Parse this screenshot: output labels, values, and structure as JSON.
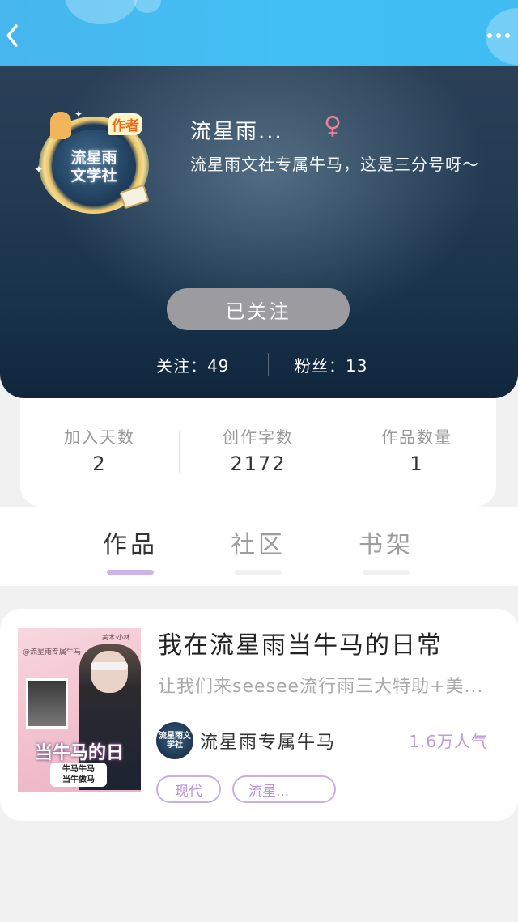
{
  "topbar": {
    "back_icon": "chevron-left-icon",
    "more_icon": "more-dots-icon",
    "color": "#41bdf3"
  },
  "profile": {
    "avatar": {
      "line1": "流星雨",
      "line2": "文学社",
      "badge": "作者"
    },
    "name": "流星雨...",
    "gender_icon": "♀",
    "bio": "流星雨文社专属牛马，这是三分号呀～",
    "follow_button": "已关注",
    "following_label": "关注：49",
    "followers_label": "粉丝：13"
  },
  "author_stats": [
    {
      "label": "加入天数",
      "value": "2"
    },
    {
      "label": "创作字数",
      "value": "2172"
    },
    {
      "label": "作品数量",
      "value": "1"
    }
  ],
  "tabs": [
    {
      "label": "作品",
      "active": true
    },
    {
      "label": "社区",
      "active": false
    },
    {
      "label": "书架",
      "active": false
    }
  ],
  "works": [
    {
      "title": "我在流星雨当牛马的日常",
      "description": "让我们来seesee流行雨三大特助+美...",
      "cover": {
        "top_text": "@流星雨专属牛马",
        "top_right": "美术·小林",
        "title": "当牛马的日常",
        "tag_line1": "牛马牛马",
        "tag_line2": "当牛做马"
      },
      "author_name": "流星雨专属牛马",
      "author_avatar_text": "流星雨文学社",
      "popularity": "1.6万人气",
      "tags": [
        "现代",
        "流星..."
      ]
    }
  ]
}
